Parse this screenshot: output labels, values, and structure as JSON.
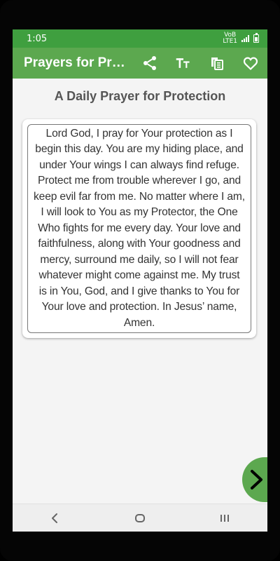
{
  "status_bar": {
    "time": "1:05",
    "network": "VoB\nLTE1"
  },
  "app_bar": {
    "title": "Prayers for Protection",
    "actions": [
      {
        "name": "share-icon"
      },
      {
        "name": "text-size-icon"
      },
      {
        "name": "copy-icon"
      },
      {
        "name": "heart-icon"
      }
    ]
  },
  "main": {
    "heading": "A Daily Prayer for Protection",
    "prayer_text": "Lord God, I pray for Your protection as I begin this day. You are my hiding place, and under Your wings I can always find refuge. Protect me from trouble wherever I go, and keep evil far from me. No matter where I am, I will look to You as my Protector, the One Who fights for me every day. Your love and faithfulness, along with Your goodness and mercy, surround me daily, so I will not fear whatever might come against me. My trust is in You, God, and I give thanks to You for Your love and protection. In Jesus’ name, Amen.",
    "next_icon": "chevron-right-icon"
  },
  "navigation": {
    "buttons": [
      "back-icon",
      "home-icon",
      "recents-icon"
    ]
  },
  "colors": {
    "status": "#3f9f3f",
    "toolbar": "#5ca84f",
    "background": "#f4f4f4",
    "text": "#333333"
  }
}
